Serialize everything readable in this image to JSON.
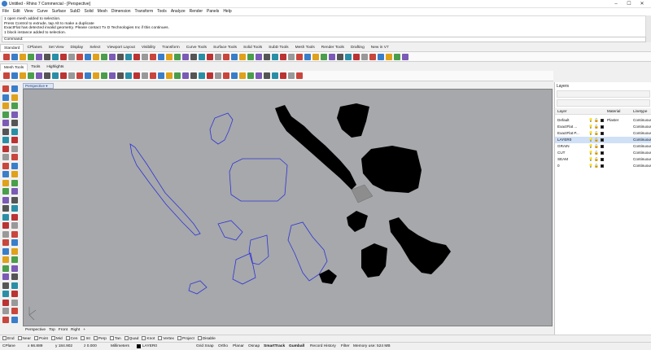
{
  "window": {
    "title": "Untitled - Rhino 7 Commercial - [Perspective]",
    "min": "–",
    "max": "☐",
    "close": "✕"
  },
  "menu": [
    "File",
    "Edit",
    "View",
    "Curve",
    "Surface",
    "SubD",
    "Solid",
    "Mesh",
    "Dimension",
    "Transform",
    "Tools",
    "Analyze",
    "Render",
    "Panels",
    "Help"
  ],
  "command_history": [
    "1 open mesh added to selection.",
    "Press Control to extrude, tap Alt to make a duplicate",
    "ExactFlat has detected invalid geometry. Please contact Tx D Technologies Inc if this continues.",
    "1 block instance added to selection."
  ],
  "command_prompt": "Command:",
  "toolbar_tabs": [
    "Standard",
    "CPlanes",
    "Set View",
    "Display",
    "Select",
    "Viewport Layout",
    "Visibility",
    "Transform",
    "Curve Tools",
    "Surface Tools",
    "Solid Tools",
    "SubD Tools",
    "Mesh Tools",
    "Render Tools",
    "Drafting",
    "New in V7"
  ],
  "secondary_tabs": [
    "Mesh Tools",
    "Tools",
    "Highlights"
  ],
  "viewport": {
    "label": "Perspective",
    "bg": "#a6a8ab",
    "curve_color": "#2f33d6",
    "solid_color": "#000000"
  },
  "viewport_tabs": [
    "Perspective",
    "Top",
    "Front",
    "Right",
    "+"
  ],
  "osnaps": [
    "End",
    "Near",
    "Point",
    "Mid",
    "Cen",
    "Int",
    "Perp",
    "Tan",
    "Quad",
    "Knot",
    "Vertex",
    "Project",
    "Disable"
  ],
  "status": {
    "cplane": "CPlane",
    "x": "x 66.889",
    "y": "y 184.902",
    "z": "z 0.000",
    "units": "Millimeters",
    "layer": "LAYER0",
    "buttons": [
      "Grid Snap",
      "Ortho",
      "Planar",
      "Osnap",
      "SmartTrack",
      "Gumball",
      "Record History",
      "Filter"
    ],
    "memory": "Memory use: 524 MB"
  },
  "layers": {
    "title": "Layers",
    "columns": [
      "Layer",
      "Material",
      "Linetype"
    ],
    "rows": [
      {
        "name": "Default",
        "material": "Plaster",
        "linetype": "Continuous",
        "color": "#000000",
        "selected": false
      },
      {
        "name": "ExactFlat ...",
        "material": "",
        "linetype": "Continuous",
        "color": "#000000",
        "selected": false
      },
      {
        "name": "ExactFlat P...",
        "material": "",
        "linetype": "Continuous",
        "color": "#000000",
        "selected": false
      },
      {
        "name": "LAYER0",
        "material": "",
        "linetype": "Continuous",
        "color": "#000000",
        "selected": true
      },
      {
        "name": "GRAIN",
        "material": "",
        "linetype": "Continuous",
        "color": "#000000",
        "selected": false
      },
      {
        "name": "CUT",
        "material": "",
        "linetype": "Continuous",
        "color": "#000000",
        "selected": false
      },
      {
        "name": "SEAM",
        "material": "",
        "linetype": "Continuous",
        "color": "#000000",
        "selected": false
      },
      {
        "name": "0",
        "material": "",
        "linetype": "Continuous",
        "color": "#000000",
        "selected": false
      }
    ]
  }
}
